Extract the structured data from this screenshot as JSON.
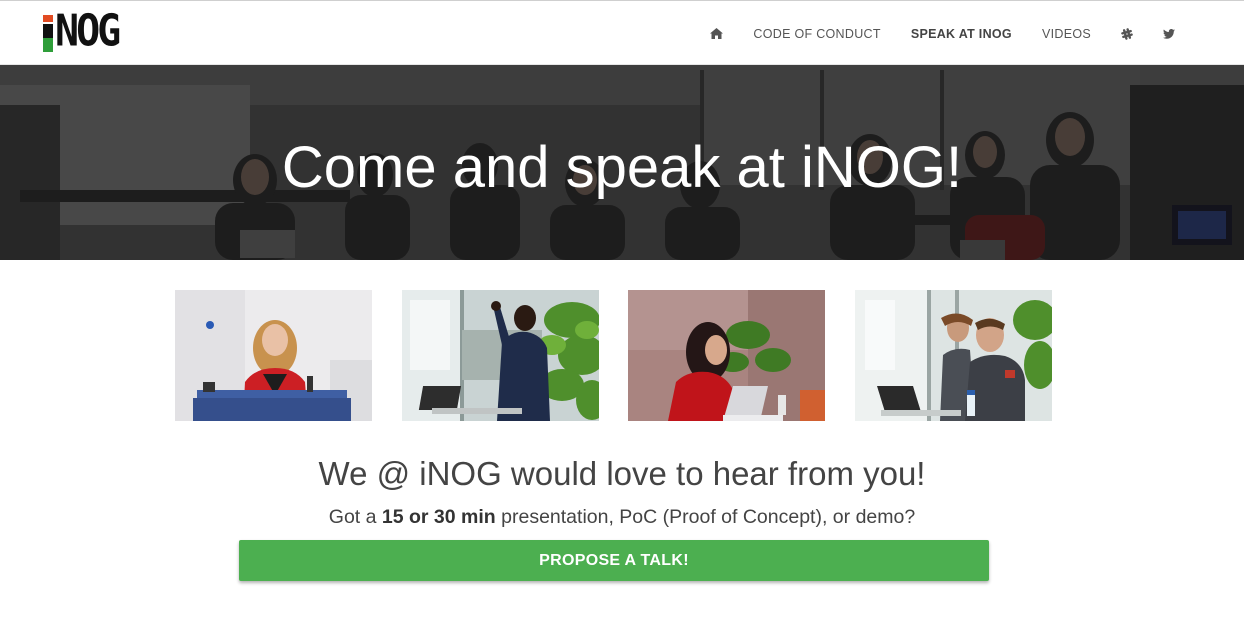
{
  "brand": {
    "logo_text": "iNOG",
    "logo_letters": "NOG",
    "colors": {
      "red": "#e24b22",
      "black": "#111111",
      "green": "#2f9e3a"
    }
  },
  "nav": {
    "home_icon": "home-icon",
    "items": [
      {
        "label": "CODE OF CONDUCT",
        "active": false
      },
      {
        "label": "SPEAK AT INOG",
        "active": true
      },
      {
        "label": "VIDEOS",
        "active": false
      }
    ],
    "slack_icon": "slack-icon",
    "twitter_icon": "twitter-icon"
  },
  "hero": {
    "title": "Come and speak at iNOG!"
  },
  "gallery": {
    "photos": [
      {
        "name": "speaker-at-podium-photo"
      },
      {
        "name": "speaker-gesturing-photo"
      },
      {
        "name": "speaker-with-laptop-photo"
      },
      {
        "name": "two-presenters-photo"
      }
    ]
  },
  "cta": {
    "heading": "We @ iNOG would love to hear from you!",
    "sub_prefix": "Got a ",
    "sub_bold": "15 or 30 min",
    "sub_suffix": " presentation, PoC (Proof of Concept), or demo?",
    "button_label": "PROPOSE A TALK!",
    "button_color": "#4caf50"
  }
}
